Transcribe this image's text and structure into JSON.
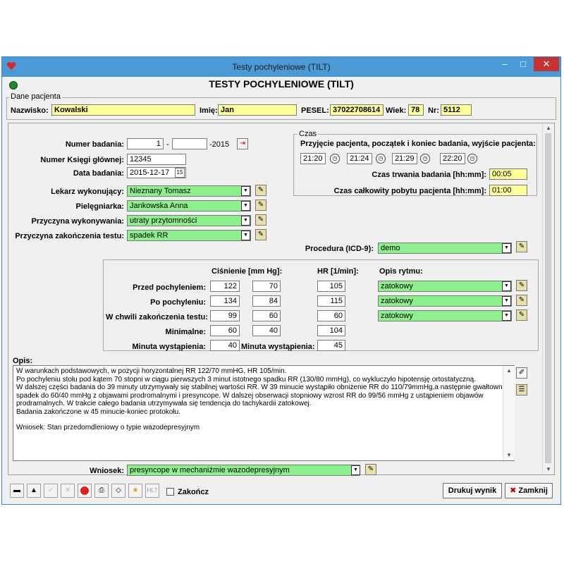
{
  "window": {
    "title": "Testy pochyleniowe (TILT)",
    "min_glyph": "–",
    "max_glyph": "□",
    "close_glyph": "✕"
  },
  "heading": "TESTY POCHYLENIOWE (TILT)",
  "patient": {
    "group_label": "Dane pacjenta",
    "surname_label": "Nazwisko:",
    "surname": "Kowalski",
    "name_label": "Imię:",
    "name": "Jan",
    "pesel_label": "PESEL:",
    "pesel": "37022708614",
    "age_label": "Wiek:",
    "age": "78",
    "nr_label": "Nr:",
    "nr": "5112"
  },
  "exam": {
    "number_label": "Numer badania:",
    "number_value": "1",
    "number_sep": "-",
    "number_suffix_value": "",
    "number_year": "-2015",
    "book_label": "Numer Księgi głównej:",
    "book_value": "12345",
    "date_label": "Data badania:",
    "date_value": "2015-12-17",
    "doctor_label": "Lekarz wykonujący:",
    "doctor_value": "Nieznany Tomasz",
    "nurse_label": "Pielęgniarka:",
    "nurse_value": "Jankowska Anna",
    "reason_label": "Przyczyna wykonywania:",
    "reason_value": "utraty przytomności",
    "end_reason_label": "Przyczyna zakończenia testu:",
    "end_reason_value": "spadek RR",
    "procedure_label": "Procedura (ICD-9):",
    "procedure_value": "demo"
  },
  "time": {
    "group_label": "Czas",
    "caption": "Przyjęcie pacjenta, początek i koniec badania, wyjście pacjenta:",
    "times": [
      "21:20",
      "21:24",
      "21:29",
      "22:20"
    ],
    "duration_label": "Czas trwania badania [hh:mm]:",
    "duration_value": "00:05",
    "total_label": "Czas całkowity pobytu pacjenta [hh:mm]:",
    "total_value": "01:00"
  },
  "measurements": {
    "pressure_header": "Ciśnienie [mm Hg]:",
    "hr_header": "HR [1/min]:",
    "rhythm_header": "Opis rytmu:",
    "rows": [
      {
        "label": "Przed pochyleniem:",
        "sys": "122",
        "dia": "70",
        "hr": "105",
        "rhythm": "zatokowy"
      },
      {
        "label": "Po pochyleniu:",
        "sys": "134",
        "dia": "84",
        "hr": "115",
        "rhythm": "zatokowy"
      },
      {
        "label": "W chwili zakończenia testu:",
        "sys": "99",
        "dia": "60",
        "hr": "60",
        "rhythm": "zatokowy"
      },
      {
        "label": "Minimalne:",
        "sys": "60",
        "dia": "40",
        "hr": "104"
      }
    ],
    "minute_label": "Minuta wystąpienia:",
    "minute_bp": "40",
    "minute_hr_label": "Minuta wystąpienia:",
    "minute_hr": "45"
  },
  "opis": {
    "label": "Opis:",
    "lines": [
      "W warunkach podstawowych, w pozycji horyzontalnej RR 122/70 mmHG, HR 105/min.",
      "Po pochyleniu stołu pod kątem 70 stopni w ciągu pierwszych 3 minut istotnego spadku RR (130/80 mmHg), co wykluczyło hipotensję ortostatyczną.",
      "W dalszej części badania do 39 minuty utrzymywały się stabilnej wartości RR. W 39 minucie wystąpiło obniżenie RR do 110/79mmHg,a następnie gwałtowny",
      "spadek do 60/40 mmHg z objawami prodromalnymi i presyncope. W dalszej obserwacji stopniowy wzrost RR do 99/56 mmHg z ustąpieniem objawów",
      "prodramalnych. W trakcie całego badania utrzymywała się tendencja do tachykardii zatokowej.",
      "Badania zakończone w 45 minucie-koniec protokołu.",
      "",
      "Wniosek: Stan przedomdleniowy o typie wazodepresyjnym"
    ]
  },
  "conclusion": {
    "label": "Wniosek:",
    "value": "presyncope w mechaniźmie wazodepresyjnym"
  },
  "toolbar": {
    "finish_label": "Zakończ",
    "print_label": "Drukuj wynik",
    "close_label": "Zamknij",
    "close_glyph": "✖",
    "hl7_label": "HL7"
  },
  "colors": {
    "titlebar": "#4a9ad8",
    "yellow_field": "#ffff99",
    "green_field": "#8cf08c",
    "close_button": "#c7312f"
  }
}
